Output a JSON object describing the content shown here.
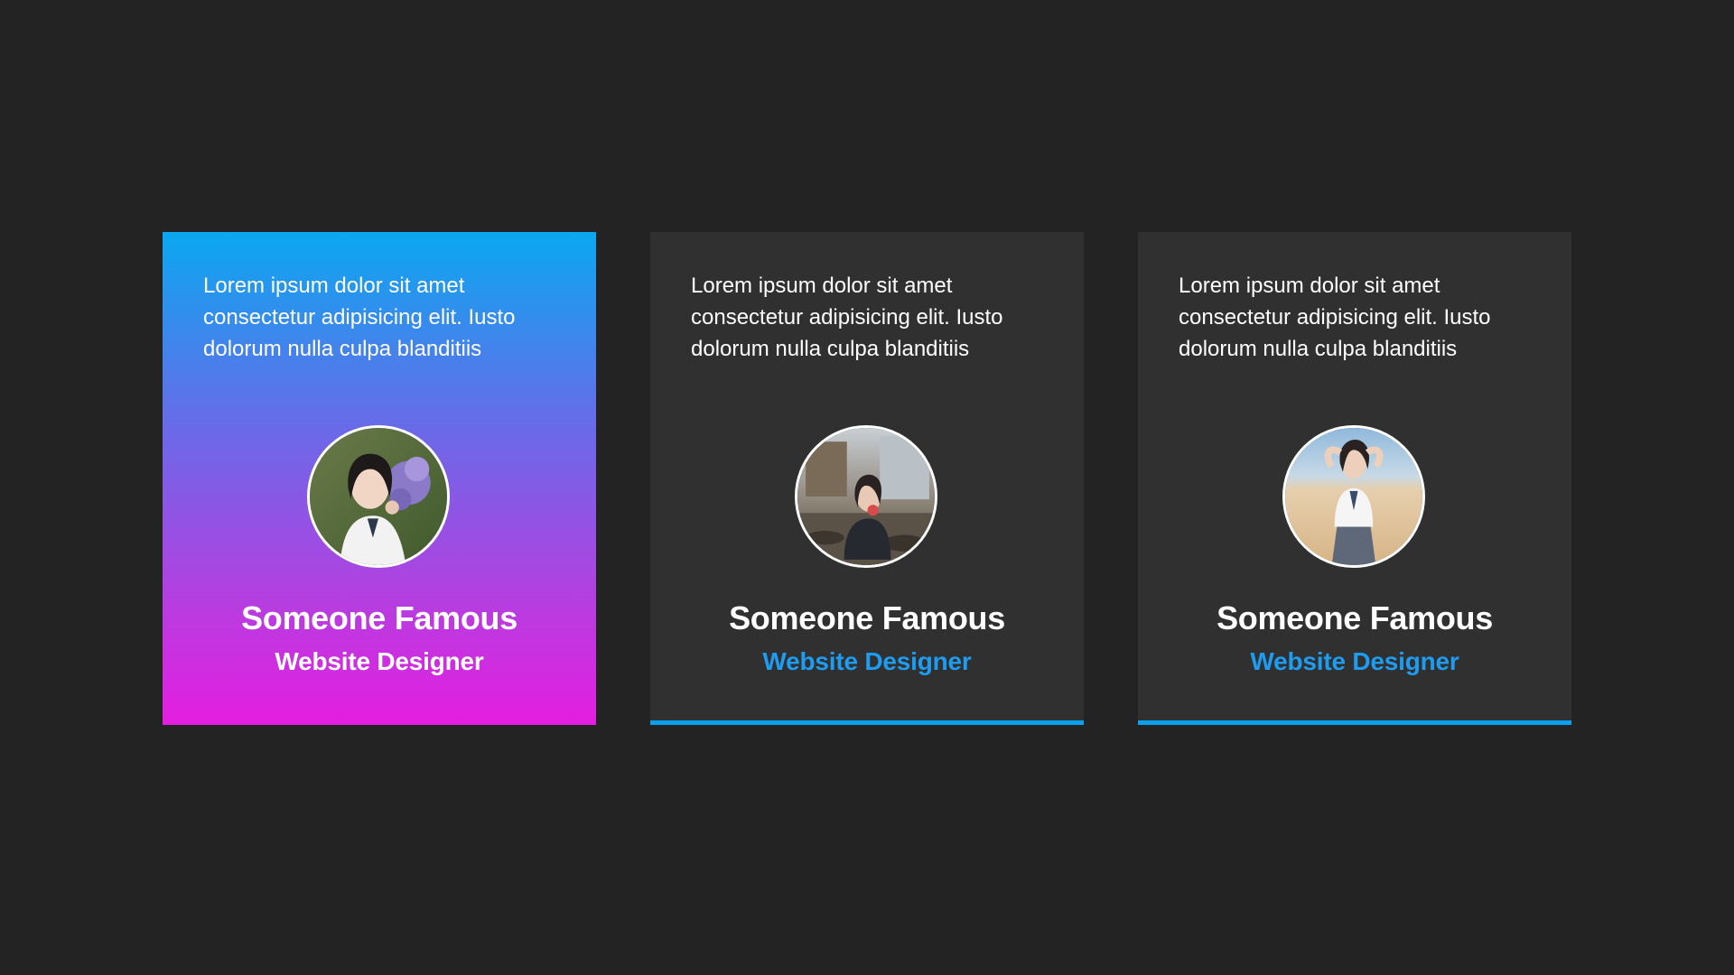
{
  "colors": {
    "background": "#232323",
    "card": "#303030",
    "accent": "#0aa0ee",
    "gradient_top": "#0aa8f0",
    "gradient_bottom": "#e41ee0"
  },
  "cards": [
    {
      "quote": "Lorem ipsum dolor sit amet consectetur adipisicing elit. Iusto dolorum nulla culpa blanditiis",
      "name": "Someone Famous",
      "role": "Website Designer",
      "avatar_icon": "avatar-photo-hydrangea",
      "active": true
    },
    {
      "quote": "Lorem ipsum dolor sit amet consectetur adipisicing elit. Iusto dolorum nulla culpa blanditiis",
      "name": "Someone Famous",
      "role": "Website Designer",
      "avatar_icon": "avatar-photo-river",
      "active": false
    },
    {
      "quote": "Lorem ipsum dolor sit amet consectetur adipisicing elit. Iusto dolorum nulla culpa blanditiis",
      "name": "Someone Famous",
      "role": "Website Designer",
      "avatar_icon": "avatar-photo-beach",
      "active": false
    }
  ]
}
